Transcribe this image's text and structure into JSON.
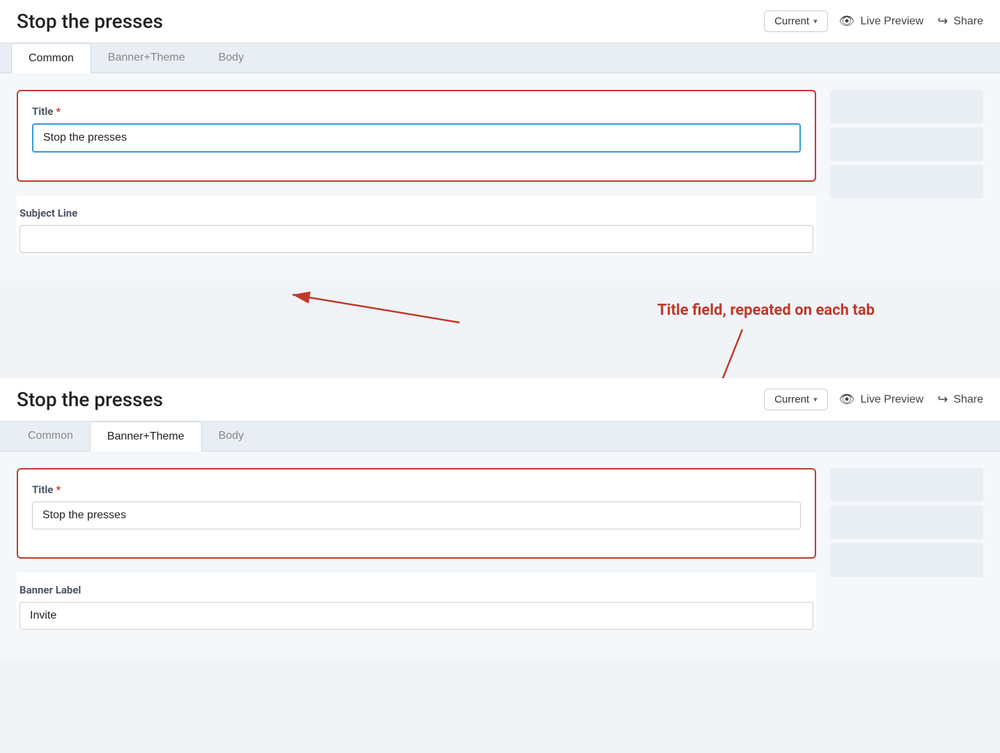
{
  "panel1": {
    "title": "Stop the presses",
    "version_label": "Current",
    "version_chevron": "▾",
    "live_preview_label": "Live Preview",
    "share_label": "Share",
    "tabs": [
      {
        "id": "common",
        "label": "Common",
        "active": true
      },
      {
        "id": "banner-theme",
        "label": "Banner+Theme",
        "active": false
      },
      {
        "id": "body",
        "label": "Body",
        "active": false
      }
    ],
    "title_field": {
      "label": "Title",
      "required": true,
      "value": "Stop the presses",
      "placeholder": ""
    },
    "subject_line_field": {
      "label": "Subject Line",
      "required": false,
      "value": "",
      "placeholder": ""
    }
  },
  "panel2": {
    "title": "Stop the presses",
    "version_label": "Current",
    "version_chevron": "▾",
    "live_preview_label": "Live Preview",
    "share_label": "Share",
    "tabs": [
      {
        "id": "common",
        "label": "Common",
        "active": false
      },
      {
        "id": "banner-theme",
        "label": "Banner+Theme",
        "active": true
      },
      {
        "id": "body",
        "label": "Body",
        "active": false
      }
    ],
    "title_field": {
      "label": "Title",
      "required": true,
      "value": "Stop the presses",
      "placeholder": ""
    },
    "banner_label_field": {
      "label": "Banner Label",
      "required": false,
      "value": "Invite",
      "placeholder": ""
    }
  },
  "annotation": {
    "text": "Title field, repeated on each tab"
  },
  "icons": {
    "eye": "👁",
    "share": "↪",
    "required_star": "*"
  }
}
